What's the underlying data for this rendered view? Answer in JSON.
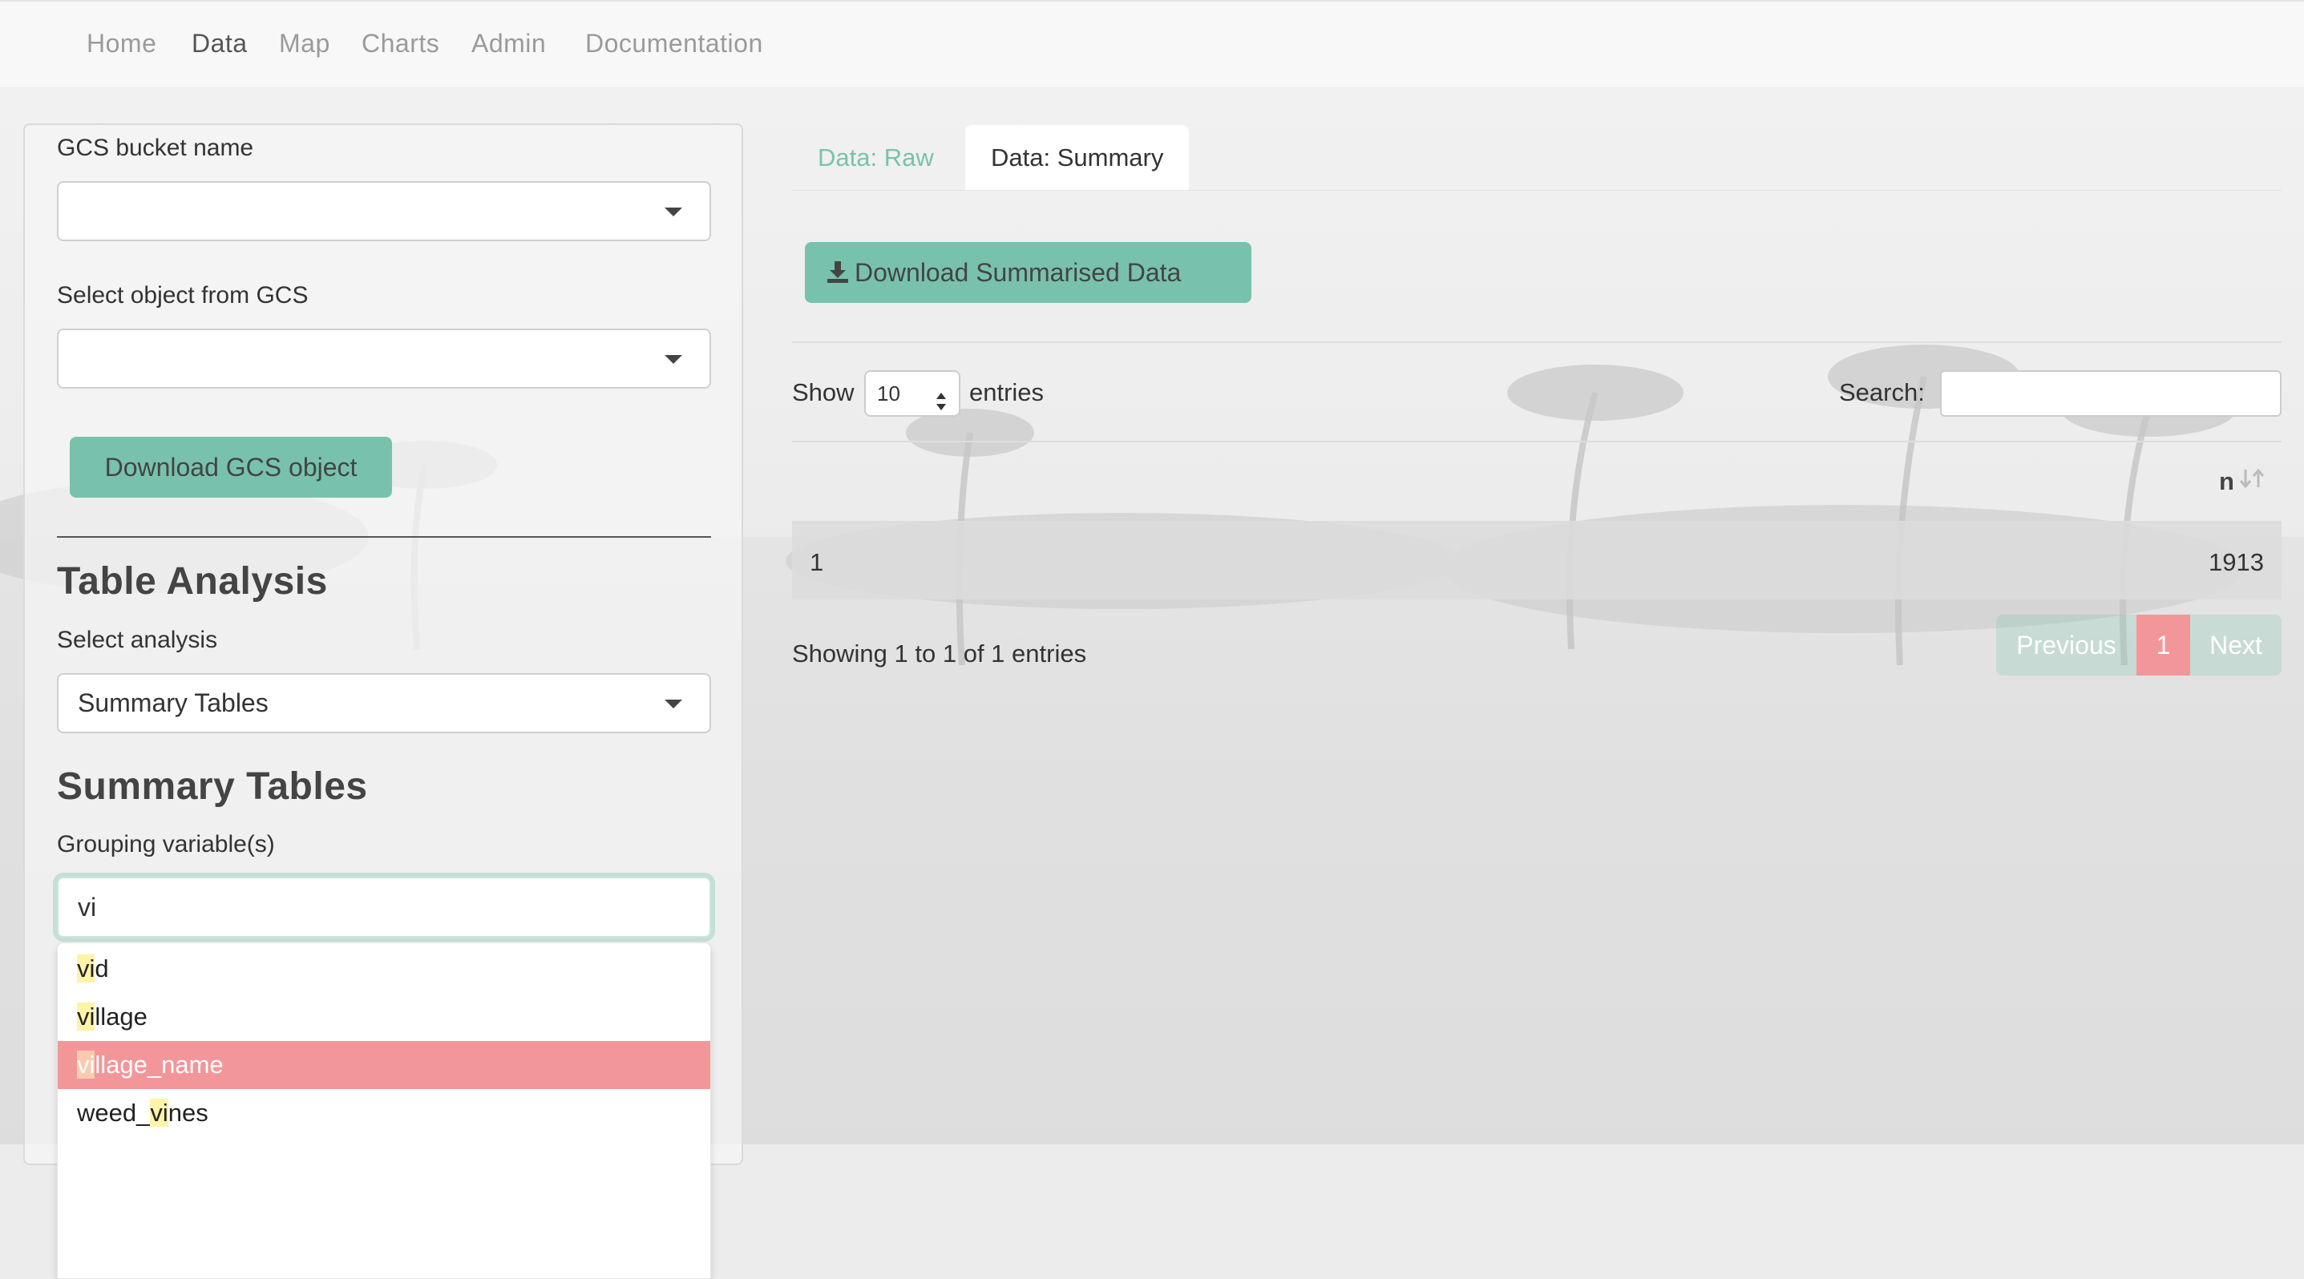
{
  "nav": {
    "items": [
      "Home",
      "Data",
      "Map",
      "Charts",
      "Admin",
      "Documentation"
    ],
    "active": "Data"
  },
  "sidebar": {
    "gcs_bucket_label": "GCS bucket name",
    "gcs_bucket_value": "",
    "gcs_object_label": "Select object from GCS",
    "gcs_object_value": "",
    "download_gcs_button": "Download GCS object",
    "table_analysis_heading": "Table Analysis",
    "select_analysis_label": "Select analysis",
    "select_analysis_value": "Summary Tables",
    "summary_tables_heading": "Summary Tables",
    "grouping_label": "Grouping variable(s)",
    "grouping_input_value": "vi",
    "dropdown_options": [
      {
        "pre": "",
        "match": "vi",
        "post": "d"
      },
      {
        "pre": "",
        "match": "vi",
        "post": "llage"
      },
      {
        "pre": "",
        "match": "vi",
        "post": "llage_name"
      },
      {
        "pre": "weed_",
        "match": "vi",
        "post": "nes"
      }
    ],
    "dropdown_selected_index": 2
  },
  "main": {
    "tabs": [
      "Data: Raw",
      "Data: Summary"
    ],
    "active_tab": "Data: Summary",
    "download_button": "Download Summarised Data",
    "show_label": "Show",
    "entries_label": "entries",
    "page_length": "10",
    "search_label": "Search:",
    "search_value": "",
    "table": {
      "columns": [
        "",
        "n"
      ],
      "rows": [
        [
          "1",
          "1913"
        ]
      ]
    },
    "info": "Showing 1 to 1 of 1 entries",
    "pagination": {
      "previous": "Previous",
      "current": "1",
      "next": "Next"
    }
  },
  "colors": {
    "accent": "#78c2ad",
    "highlight": "#f3969a",
    "match": "#fff3a8"
  },
  "icons": [
    "caret-down-icon",
    "download-icon",
    "sort-icon",
    "spinner-arrows-icon"
  ]
}
